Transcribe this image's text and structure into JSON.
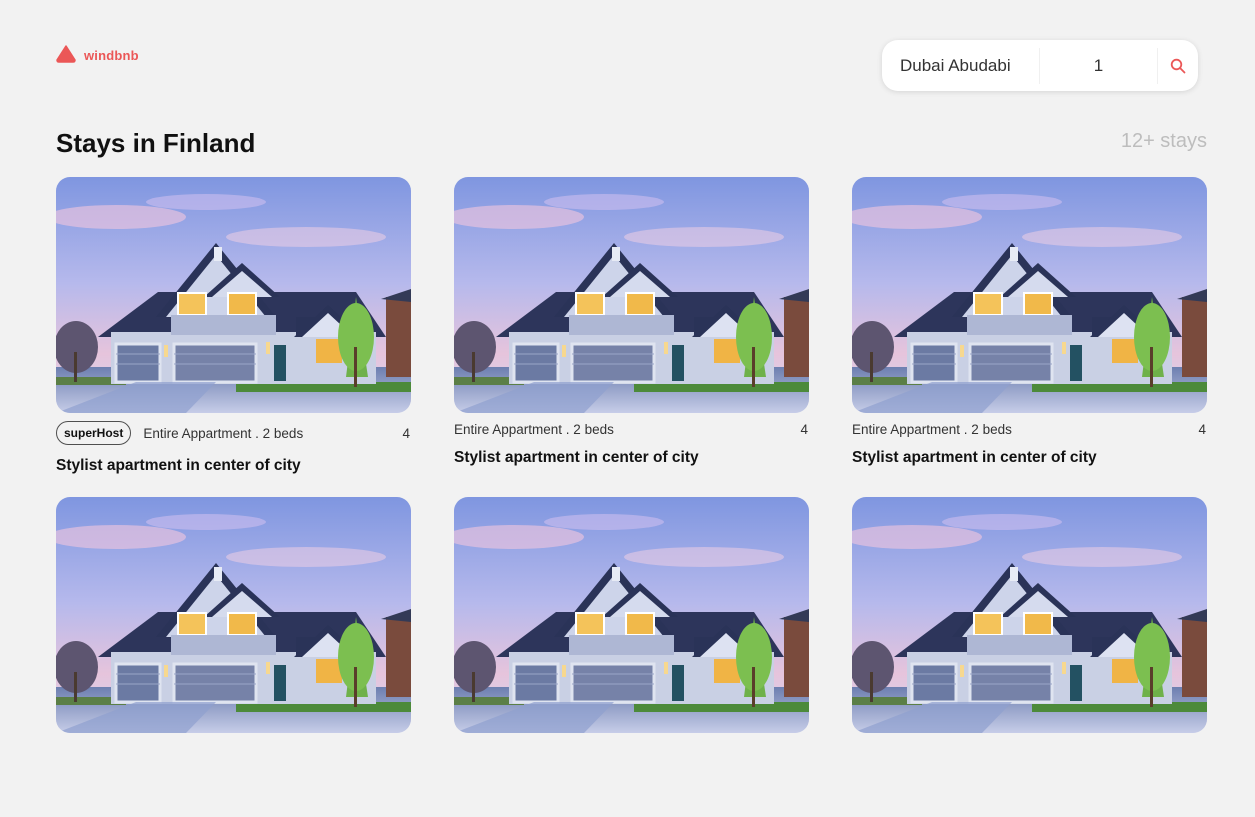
{
  "brand": {
    "name": "windbnb",
    "accent": "#eb5757"
  },
  "search": {
    "location": "Dubai Abudabi",
    "guests": "1",
    "icon": "search-icon"
  },
  "header": {
    "title": "Stays in Finland",
    "count": "12+ stays"
  },
  "stays": [
    {
      "superhost_label": "superHost",
      "type": "Entire Appartment . 2 beds",
      "rating": "4",
      "title": "Stylist apartment in center of city"
    },
    {
      "type": "Entire Appartment . 2 beds",
      "rating": "4",
      "title": "Stylist apartment in center of city"
    },
    {
      "type": "Entire Appartment . 2 beds",
      "rating": "4",
      "title": "Stylist apartment in center of city"
    },
    {
      "type": "",
      "rating": "",
      "title": ""
    },
    {
      "type": "",
      "rating": "",
      "title": ""
    },
    {
      "type": "",
      "rating": "",
      "title": ""
    }
  ]
}
